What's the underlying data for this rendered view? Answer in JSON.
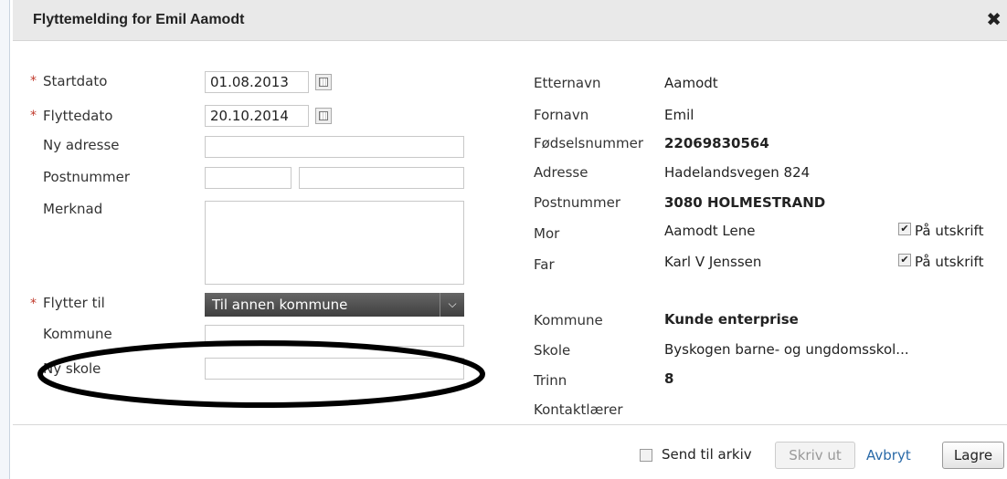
{
  "dialog": {
    "title": "Flyttemelding for Emil Aamodt",
    "close_icon": "close-icon",
    "close_glyph": "✖"
  },
  "form": {
    "required_mark": "*",
    "startdato": {
      "label": "Startdato",
      "value": "01.08.2013"
    },
    "flyttedato": {
      "label": "Flyttedato",
      "value": "20.10.2014"
    },
    "ny_adresse": {
      "label": "Ny adresse",
      "value": ""
    },
    "postnummer": {
      "label": "Postnummer",
      "value1": "",
      "value2": ""
    },
    "merknad": {
      "label": "Merknad",
      "value": ""
    },
    "flytter_til": {
      "label": "Flytter til",
      "value": "Til annen kommune"
    },
    "kommune": {
      "label": "Kommune",
      "value": ""
    },
    "ny_skole": {
      "label": "Ny skole",
      "value": ""
    }
  },
  "info": {
    "etternavn": {
      "label": "Etternavn",
      "value": "Aamodt"
    },
    "fornavn": {
      "label": "Fornavn",
      "value": "Emil"
    },
    "fodselsnummer": {
      "label": "Fødselsnummer",
      "value": "22069830564"
    },
    "adresse": {
      "label": "Adresse",
      "value": "Hadelandsvegen 824"
    },
    "postnummer": {
      "label": "Postnummer",
      "value": "3080 HOLMESTRAND"
    },
    "mor": {
      "label": "Mor",
      "value": "Aamodt Lene",
      "print_label": "På utskrift",
      "checked": true
    },
    "far": {
      "label": "Far",
      "value": "Karl V Jenssen",
      "print_label": "På utskrift",
      "checked": true
    },
    "kommune": {
      "label": "Kommune",
      "value": "Kunde enterprise"
    },
    "skole": {
      "label": "Skole",
      "value": "Byskogen barne- og ungdomsskol..."
    },
    "trinn": {
      "label": "Trinn",
      "value": "8"
    },
    "kontaktlaerer": {
      "label": "Kontaktlærer",
      "value": ""
    }
  },
  "footer": {
    "archive_label": "Send til arkiv",
    "archive_checked": false,
    "print_button": "Skriv ut",
    "cancel_link": "Avbryt",
    "save_button": "Lagre"
  },
  "icons": {
    "calendar": "calendar-icon",
    "dropdown": "chevron-down-icon",
    "checkmark": "✔"
  }
}
